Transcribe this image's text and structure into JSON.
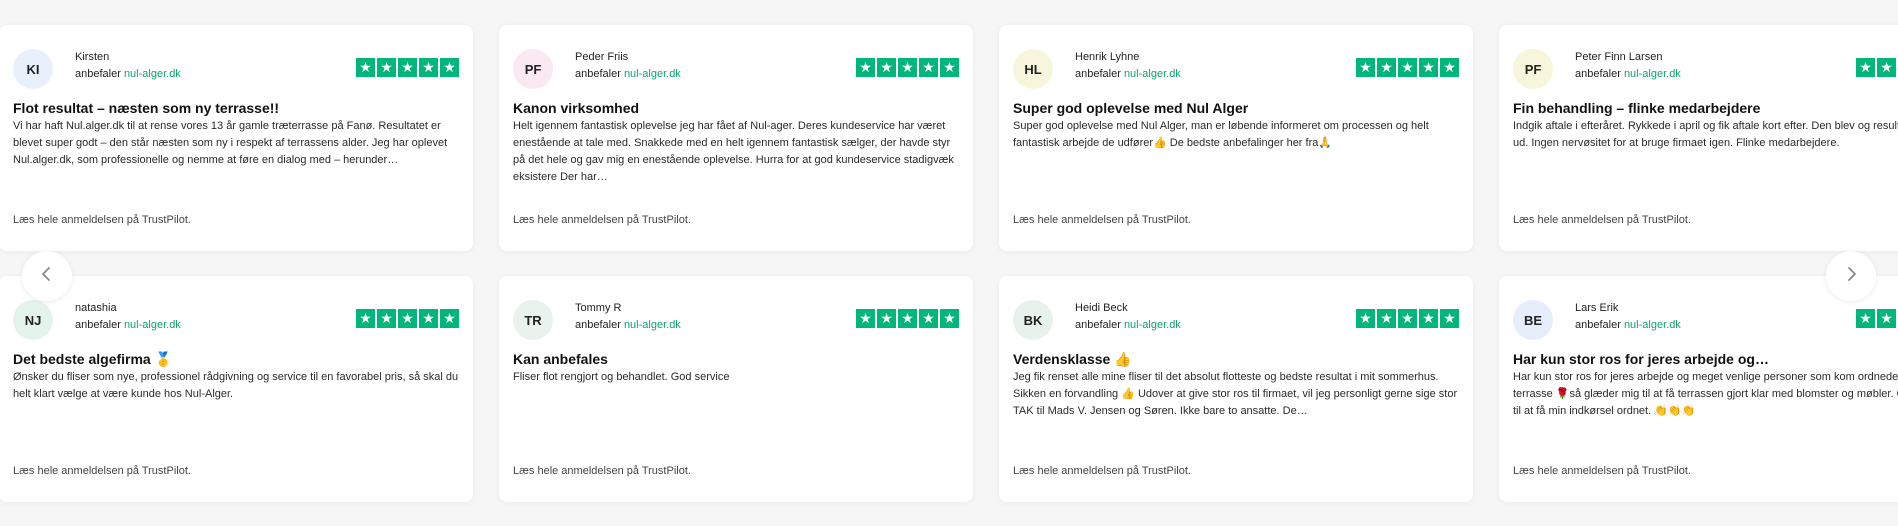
{
  "rating_symbol": "★",
  "colors": {
    "star_bg": "#00b67a",
    "link_green": "#10a36a",
    "card_bg": "#ffffff",
    "page_bg": "#f6f6f7"
  },
  "icons": {
    "prev": "chevron-left-icon",
    "next": "chevron-right-icon",
    "rating": "star-icon"
  },
  "reviews": [
    {
      "initials": "KI",
      "avatar_color": "#e8f0fb",
      "name": "Kirsten",
      "recommend_prefix": "anbefaler",
      "site": "nul-alger.dk",
      "title": "Flot resultat – næsten som ny terrasse!!",
      "body": "Vi har haft Nul.alger.dk til at rense vores 13 år gamle træterrasse på Fanø. Resultatet er blevet super godt – den står næsten som ny i respekt af terrassens alder. Jeg har oplevet Nul.alger.dk, som professionelle og nemme at føre en dialog med – herunder…",
      "read_more": "Læs hele anmeldelsen på TrustPilot."
    },
    {
      "initials": "PF",
      "avatar_color": "#fbe9f1",
      "name": "Peder Friis",
      "recommend_prefix": "anbefaler",
      "site": "nul-alger.dk",
      "title": "Kanon virksomhed",
      "body": "Helt igennem fantastisk oplevelse jeg har fået af Nul-ager. Deres kundeservice har været enestående at tale med. Snakkede med en helt igennem fantastisk sælger, der havde styr på det hele og gav mig en enestående oplevelse. Hurra for at god kundeservice stadigvæk eksistere Der har…",
      "read_more": "Læs hele anmeldelsen på TrustPilot."
    },
    {
      "initials": "HL",
      "avatar_color": "#f7f6dc",
      "name": "Henrik Lyhne",
      "recommend_prefix": "anbefaler",
      "site": "nul-alger.dk",
      "title": "Super god oplevelse med Nul Alger",
      "body": "Super god oplevelse med Nul Alger, man er løbende informeret om processen og helt fantastisk arbejde de udfører👍 De bedste anbefalinger her fra🙏",
      "read_more": "Læs hele anmeldelsen på TrustPilot."
    },
    {
      "initials": "PF",
      "avatar_color": "#f7f6dc",
      "name": "Peter Finn Larsen",
      "recommend_prefix": "anbefaler",
      "site": "nul-alger.dk",
      "title": "Fin behandling – flinke medarbejdere",
      "body": "Indgik aftale i efteråret. Rykkede i april og fik aftale kort efter. Den blev og resultatet ser fint ud. Ingen nervøsitet for at bruge firmaet igen. Flinke medarbejdere.",
      "read_more": "Læs hele anmeldelsen på TrustPilot."
    },
    {
      "initials": "NJ",
      "avatar_color": "#e4f3ec",
      "name": "natashia",
      "recommend_prefix": "anbefaler",
      "site": "nul-alger.dk",
      "title": "Det bedste algefirma 🥇",
      "body": "Ønsker du fliser som nye, professionel rådgivning og service til en favorabel pris, så skal du helt klart vælge at være kunde hos Nul-Alger.",
      "read_more": "Læs hele anmeldelsen på TrustPilot."
    },
    {
      "initials": "TR",
      "avatar_color": "#e9f2ec",
      "name": "Tommy R",
      "recommend_prefix": "anbefaler",
      "site": "nul-alger.dk",
      "title": "Kan anbefales",
      "body": "Fliser flot rengjort og behandlet. God service",
      "read_more": "Læs hele anmeldelsen på TrustPilot."
    },
    {
      "initials": "BK",
      "avatar_color": "#e7f2ed",
      "name": "Heidi Beck",
      "recommend_prefix": "anbefaler",
      "site": "nul-alger.dk",
      "title": "Verdensklasse 👍",
      "body": "Jeg fik renset alle mine fliser til det absolut flotteste og bedste resultat i mit sommerhus. Sikken en forvandling 👍 Udover at give stor ros til firmaet, vil jeg personligt gerne sige stor TAK til Mads V. Jensen og Søren. Ikke bare to ansatte. De…",
      "read_more": "Læs hele anmeldelsen på TrustPilot."
    },
    {
      "initials": "BE",
      "avatar_color": "#e6eefb",
      "name": "Lars Erik",
      "recommend_prefix": "anbefaler",
      "site": "nul-alger.dk",
      "title": "Har kun stor ros for jeres arbejde og…",
      "body": "Har kun stor ros for jeres arbejde og meget venlige personer som kom ordnede vores terrasse 🌹så glæder mig til at få terrassen gjort klar med blomster og møbler. Glæder mig til at få min indkørsel ordnet. 👏👏👏",
      "read_more": "Læs hele anmeldelsen på TrustPilot."
    }
  ]
}
